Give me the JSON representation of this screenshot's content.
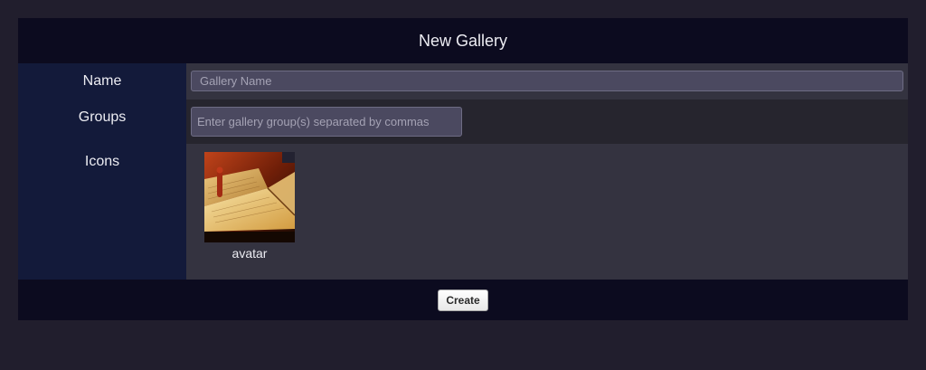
{
  "header": {
    "title": "New Gallery"
  },
  "form": {
    "name": {
      "label": "Name",
      "value": "",
      "placeholder": "Gallery Name"
    },
    "groups": {
      "label": "Groups",
      "value": "",
      "placeholder": "Enter gallery group(s) separated by commas"
    },
    "icons": {
      "label": "Icons",
      "items": [
        {
          "caption": "avatar",
          "image": "open-book-photo"
        }
      ]
    }
  },
  "footer": {
    "create_label": "Create"
  },
  "colors": {
    "page_bg": "#211e2d",
    "panel_bg": "#0c0b1f",
    "label_column_bg": "#131a3a",
    "input_bg": "#4b4960"
  }
}
